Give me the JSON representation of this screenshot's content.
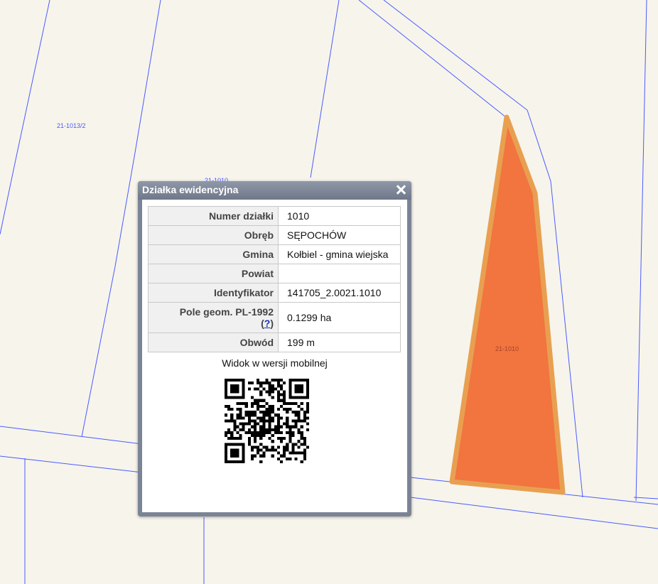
{
  "map": {
    "parcel_labels": [
      "21-1013/2",
      "21-1010",
      "21-1010"
    ],
    "highlight_color": "#f2743f",
    "highlight_border_color": "#e8a050",
    "line_color": "#4a5cff"
  },
  "popup": {
    "title": "Działka ewidencyjna",
    "close_icon": "close-icon",
    "rows": [
      {
        "key": "Numer działki",
        "value": "1010"
      },
      {
        "key": "Obręb",
        "value": "SĘPOCHÓW"
      },
      {
        "key": "Gmina",
        "value": "Kołbiel - gmina wiejska"
      },
      {
        "key": "Powiat",
        "value": ""
      },
      {
        "key": "Identyfikator",
        "value": "141705_2.0021.1010"
      },
      {
        "key": "Pole geom. PL-1992",
        "help_link": "?",
        "value": "0.1299 ha"
      },
      {
        "key": "Obwód",
        "value": "199 m"
      }
    ],
    "mobile_label": "Widok w wersji mobilnej",
    "qr_icon": "qr-code-icon"
  }
}
